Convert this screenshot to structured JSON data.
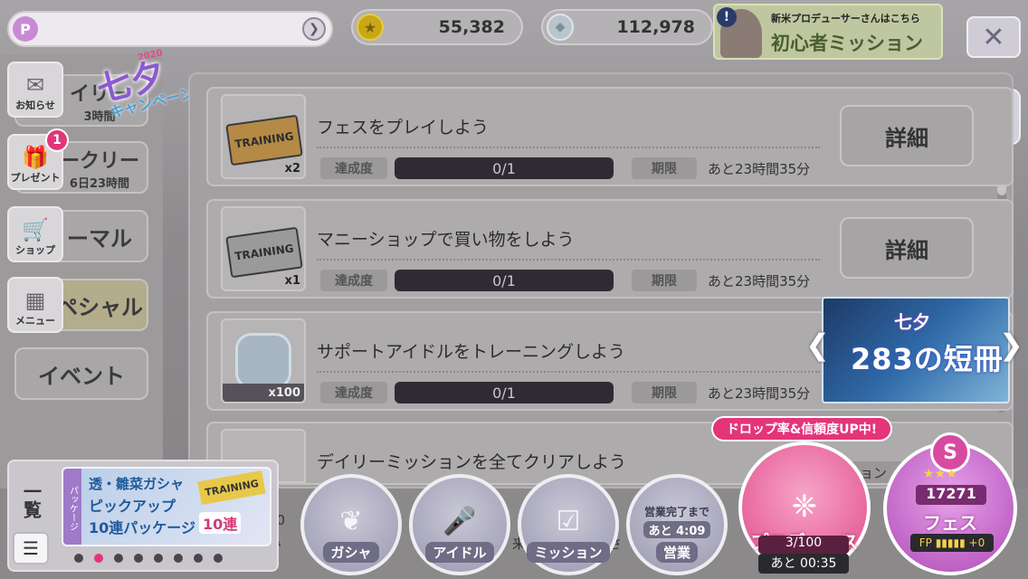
{
  "header": {
    "p_badge": "P",
    "coins": "55,382",
    "gems": "112,978",
    "banner_caption": "新米プロデューサーさんはこちら",
    "banner_title": "初心者ミッション"
  },
  "campaign": {
    "year": "2020",
    "title": "七夕",
    "subtitle": "キャンペーン"
  },
  "tabs": [
    {
      "label": "イリー",
      "sub": "3時間"
    },
    {
      "label": "ークリー",
      "sub": "6日23時間"
    },
    {
      "label": "ーマル",
      "sub": ""
    },
    {
      "label": "ペシャル",
      "sub": ""
    },
    {
      "label": "イベント",
      "sub": ""
    }
  ],
  "side_icons": [
    "お知らせ",
    "プレゼント",
    "ショップ",
    "メニュー"
  ],
  "present_badge": "1",
  "labels": {
    "progress": "達成度",
    "deadline": "期限",
    "detail": "詳細"
  },
  "missions": [
    {
      "title": "フェスをプレイしよう",
      "qty": "x2",
      "progress": "0/1",
      "deadline": "あと23時間35分"
    },
    {
      "title": "マニーショップで買い物をしよう",
      "qty": "x1",
      "progress": "0/1",
      "deadline": "あと23時間35分"
    },
    {
      "title": "サポートアイドルをトレーニングしよう",
      "qty": "x100",
      "progress": "0/1",
      "deadline": "あと23時間35分"
    },
    {
      "title": "デイリーミッションを全てクリアしよう",
      "qty": "",
      "progress": "",
      "deadline": ""
    }
  ],
  "event_banner": {
    "title": "七夕",
    "subtitle": "283の短冊"
  },
  "footer": {
    "text_a": "00",
    "text_b": "み",
    "text_c": "来",
    "text_d": "さ",
    "text_e": "ョン"
  },
  "package_panel": {
    "list_label": "一覧",
    "side_label": "パッケージ",
    "line1": "透・雛菜ガシャ",
    "line2": "ピックアップ",
    "line3": "10連パッケージ",
    "ticket": "TRAINING",
    "count": "10連"
  },
  "nav": {
    "gacha": "ガシャ",
    "idol": "アイドル",
    "mission": "ミッション",
    "business_caption": "営業完了まで",
    "business_timer": "あと 4:09",
    "business": "営業"
  },
  "produce": {
    "drop_banner": "ドロップ率&信頼度UP中!",
    "label": "プロデュース",
    "stamina": "3/100",
    "timer": "あと 00:35"
  },
  "fes": {
    "rank": "S",
    "stars": "★★★",
    "score": "17271",
    "label": "フェス",
    "fp": "FP ▮▮▮▮▮ +0"
  }
}
